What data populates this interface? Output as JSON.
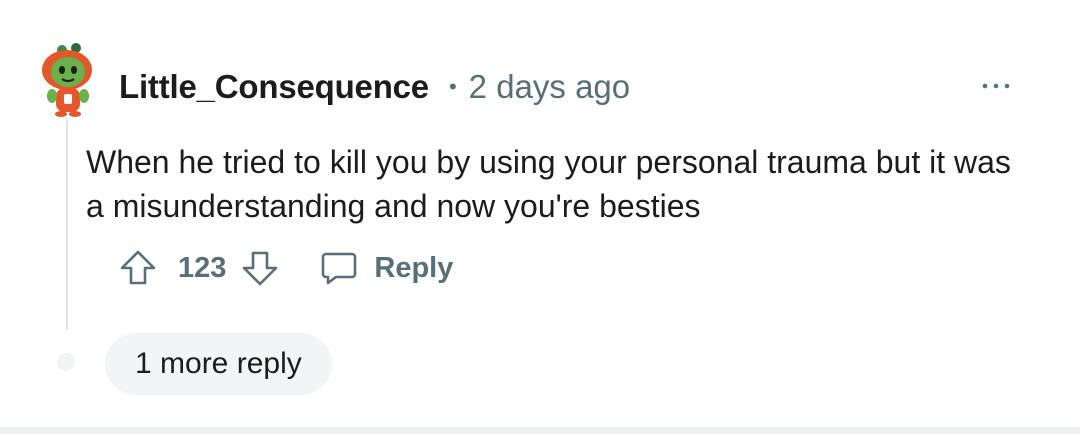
{
  "comment": {
    "username": "Little_Consequence",
    "separator": "•",
    "timestamp": "2 days ago",
    "body": "When he tried to kill you by using your personal trauma but it was a misunderstanding and now you're besties",
    "score": "123",
    "reply_label": "Reply",
    "more_replies_label": "1 more reply"
  },
  "icons": {
    "avatar": "snoo-avatar-orange-hoodie",
    "more": "more-dots-icon",
    "upvote": "upvote-arrow-icon",
    "downvote": "downvote-arrow-icon",
    "reply": "comment-bubble-icon"
  },
  "colors": {
    "text_primary": "#1c1c1c",
    "text_secondary": "#576f76",
    "avatar_orange": "#e2582a",
    "avatar_green": "#6ab04c",
    "pill_background": "#f2f4f5"
  }
}
